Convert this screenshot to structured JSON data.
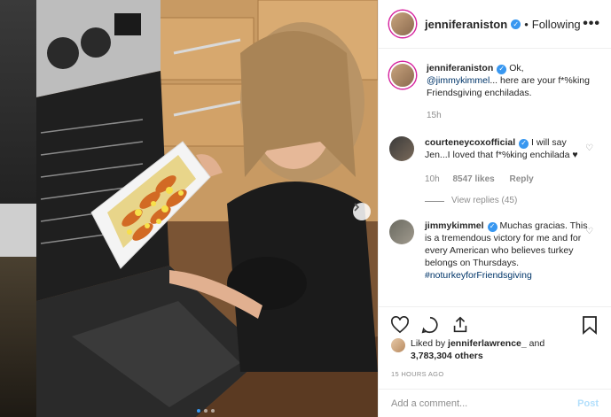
{
  "post": {
    "author": "jenniferaniston",
    "follow_status": "Following",
    "separator": "•",
    "more_glyph": "•••",
    "caption": {
      "author": "jenniferaniston",
      "text_prefix": "Ok,",
      "mention": "@jimmykimmel",
      "text_suffix": "... here are your f*%king Friendsgiving enchiladas.",
      "time": "15h"
    },
    "comments": [
      {
        "author": "courteneycoxofficial",
        "text": "I will say Jen...I loved that f*%king enchilada ♥",
        "time": "10h",
        "likes": "8547 likes",
        "reply_label": "Reply",
        "view_replies": "View replies (45)"
      },
      {
        "author": "jimmykimmel",
        "text": "Muchas gracias. This is a tremendous victory for me and for every American who believes turkey belongs on Thursdays.",
        "hashtag": "#noturkeyforFriendsgiving"
      }
    ],
    "liked_by": {
      "prefix": "Liked by",
      "user": "jenniferlawrence_",
      "and": "and",
      "others": "3,783,304 others"
    },
    "timestamp": "15 HOURS AGO",
    "add_comment": {
      "placeholder": "Add a comment...",
      "post_label": "Post"
    },
    "carousel": {
      "count": 3,
      "active_index": 0
    }
  },
  "colors": {
    "verified": "#3897f0",
    "mention": "#003569",
    "muted": "#8e8e8e",
    "post_disabled": "#b2dffc"
  },
  "icons": [
    "verified-badge-icon",
    "more-options-icon",
    "heart-icon",
    "comment-icon",
    "share-icon",
    "bookmark-icon",
    "chevron-right-icon",
    "small-heart-icon"
  ]
}
